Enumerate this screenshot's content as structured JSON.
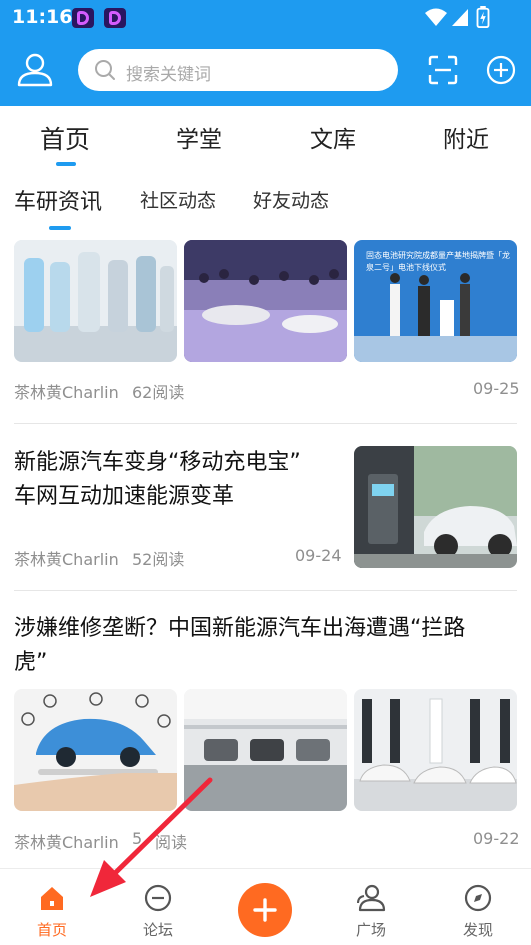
{
  "status": {
    "time": "11:16"
  },
  "search": {
    "placeholder": "搜索关键词"
  },
  "tabs": [
    {
      "label": "首页",
      "active": true
    },
    {
      "label": "学堂"
    },
    {
      "label": "文库"
    },
    {
      "label": "附近"
    }
  ],
  "subtabs": [
    {
      "label": "车研资讯",
      "active": true
    },
    {
      "label": "社区动态"
    },
    {
      "label": "好友动态"
    }
  ],
  "articles": [
    {
      "images": [
        "battery-cells-photo",
        "auto-show-crowd-photo",
        "battery-line-ceremony-photo"
      ],
      "ceremony_banner": "固态电池研究院成都量产基地揭牌暨「龙泉二号」电池下线仪式",
      "author": "茶林黄Charlin",
      "reads": "62阅读",
      "date": "09-25"
    },
    {
      "title_line1": "新能源汽车变身“移动充电宝”",
      "title_line2": "车网互动加速能源变革",
      "images": [
        "charging-station-photo"
      ],
      "author": "茶林黄Charlin",
      "reads": "52阅读",
      "date": "09-24"
    },
    {
      "title_line1": "涉嫌维修垄断？中国新能源汽车出海遭遇“拦路",
      "title_line2": "虎”",
      "images": [
        "tablet-car-diagram-photo",
        "service-workshop-photo",
        "showroom-photo"
      ],
      "author": "茶林黄Charlin",
      "reads": "5",
      "reads_tail": "阅读",
      "date": "09-22"
    }
  ],
  "bottom_nav": [
    {
      "label": "首页",
      "icon": "home-icon",
      "active": true
    },
    {
      "label": "论坛",
      "icon": "forum-icon"
    },
    {
      "label": "",
      "icon": "plus-icon"
    },
    {
      "label": "广场",
      "icon": "people-icon"
    },
    {
      "label": "发现",
      "icon": "discover-icon"
    }
  ],
  "colors": {
    "brand": "#1e9bf0",
    "accent": "#ff6a21",
    "annotation_arrow": "#f0273a"
  }
}
